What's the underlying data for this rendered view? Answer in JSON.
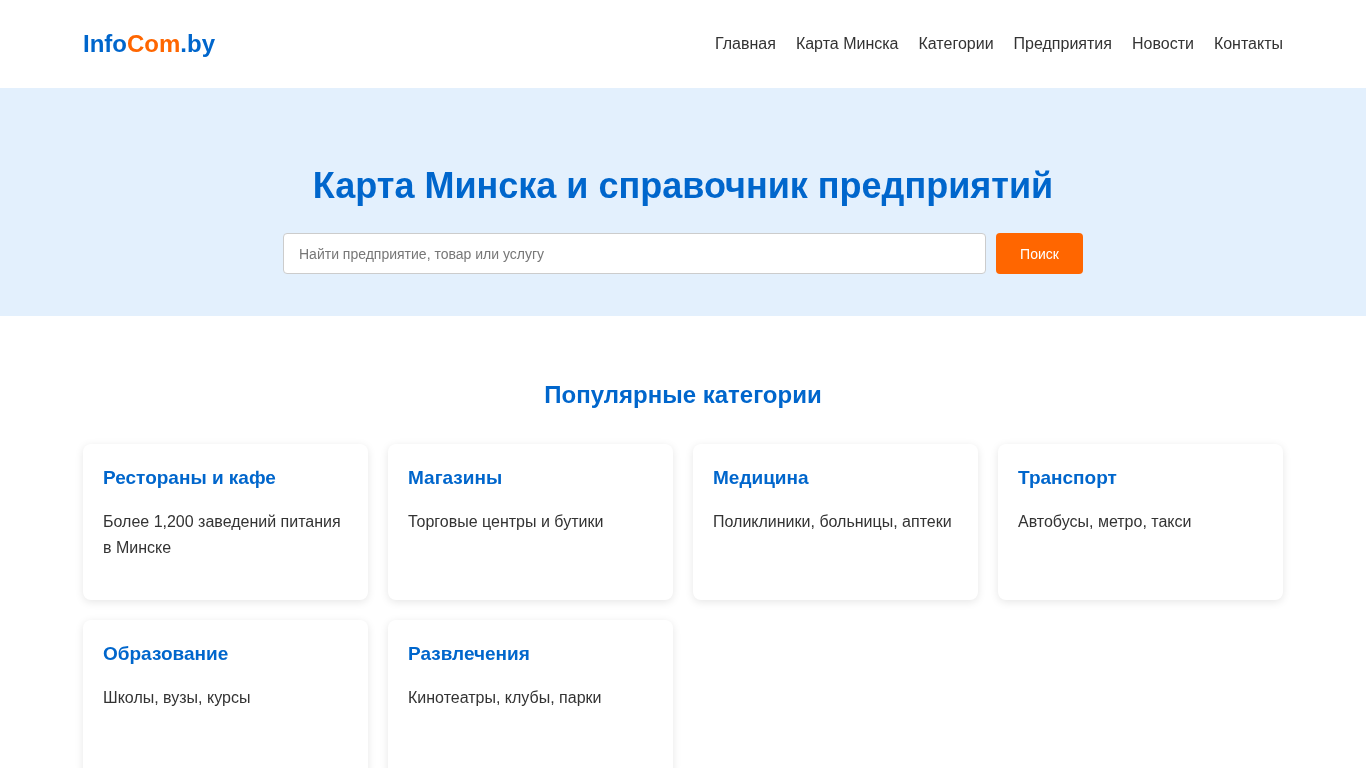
{
  "logo": {
    "parts": [
      {
        "text": "Info",
        "color": "#0066cc"
      },
      {
        "text": "Com",
        "color": "#ff6600"
      },
      {
        "text": ".by",
        "color": "#0066cc"
      }
    ]
  },
  "nav": [
    "Главная",
    "Карта Минска",
    "Категории",
    "Предприятия",
    "Новости",
    "Контакты"
  ],
  "hero": {
    "title": "Карта Минска и справочник предприятий",
    "search": {
      "placeholder": "Найти предприятие, товар или услугу"
    },
    "button": "Поиск"
  },
  "categories": {
    "title": "Популярные категории",
    "items": [
      {
        "title": "Рестораны и кафе",
        "description": "Более 1,200 заведений питания в Минске"
      },
      {
        "title": "Магазины",
        "description": "Торговые центры и бутики"
      },
      {
        "title": "Медицина",
        "description": "Поликлиники, больницы, аптеки"
      },
      {
        "title": "Транспорт",
        "description": "Автобусы, метро, такси"
      },
      {
        "title": "Образование",
        "description": "Школы, вузы, курсы"
      },
      {
        "title": "Развлечения",
        "description": "Кинотеатры, клубы, парки"
      }
    ]
  }
}
